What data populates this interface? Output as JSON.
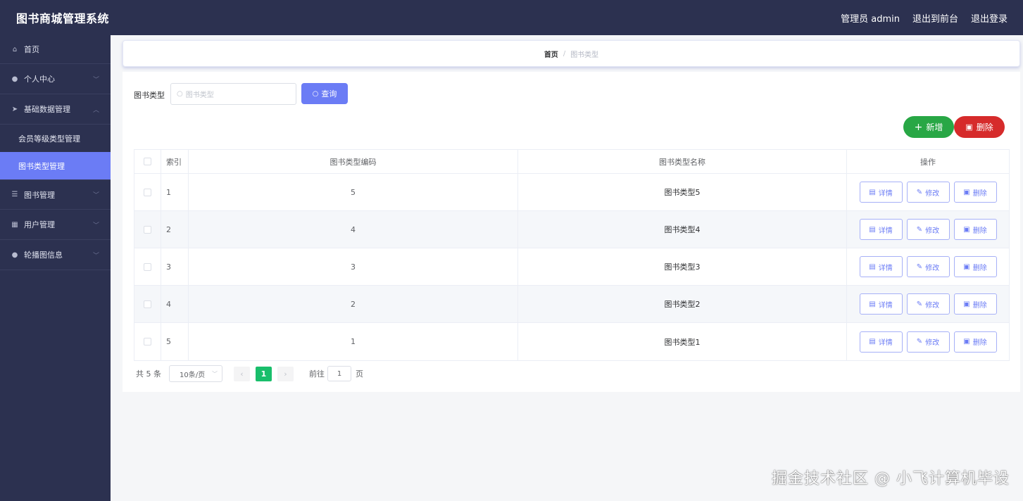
{
  "app": {
    "title": "图书商城管理系统"
  },
  "header": {
    "admin_label": "管理员 admin",
    "front_label": "退出到前台",
    "logout_label": "退出登录"
  },
  "sidebar": {
    "items": [
      {
        "label": "首页",
        "icon": "home-icon"
      },
      {
        "label": "个人中心",
        "icon": "user-icon"
      },
      {
        "label": "基础数据管理",
        "icon": "send-icon"
      },
      {
        "label": "会员等级类型管理"
      },
      {
        "label": "图书类型管理",
        "active": true
      },
      {
        "label": "图书管理",
        "icon": "sliders-icon"
      },
      {
        "label": "用户管理",
        "icon": "grid-icon"
      },
      {
        "label": "轮播图信息",
        "icon": "user-icon"
      }
    ]
  },
  "breadcrumb": {
    "home": "首页",
    "sep": "/",
    "current": "图书类型"
  },
  "search": {
    "label": "图书类型",
    "placeholder": "图书类型",
    "button": "查询"
  },
  "actions": {
    "add": "新增",
    "delete": "删除"
  },
  "table": {
    "headers": {
      "index": "索引",
      "code": "图书类型编码",
      "name": "图书类型名称",
      "ops": "操作"
    },
    "rows": [
      {
        "index": "1",
        "code": "5",
        "name": "图书类型5"
      },
      {
        "index": "2",
        "code": "4",
        "name": "图书类型4"
      },
      {
        "index": "3",
        "code": "3",
        "name": "图书类型3"
      },
      {
        "index": "4",
        "code": "2",
        "name": "图书类型2"
      },
      {
        "index": "5",
        "code": "1",
        "name": "图书类型1"
      }
    ],
    "row_actions": {
      "detail": "详情",
      "edit": "修改",
      "delete": "删除"
    }
  },
  "pagination": {
    "total": "共 5 条",
    "page_size": "10条/页",
    "current_page": "1",
    "goto_label": "前往",
    "goto_value": "1",
    "page_suffix": "页"
  },
  "watermark": "掘金技术社区 @ 小飞计算机毕设",
  "colors": {
    "sidebar": "#2c3150",
    "accent": "#6b7cf5",
    "add": "#28a745",
    "delete": "#d62b2b",
    "page_active": "#19be6b"
  }
}
